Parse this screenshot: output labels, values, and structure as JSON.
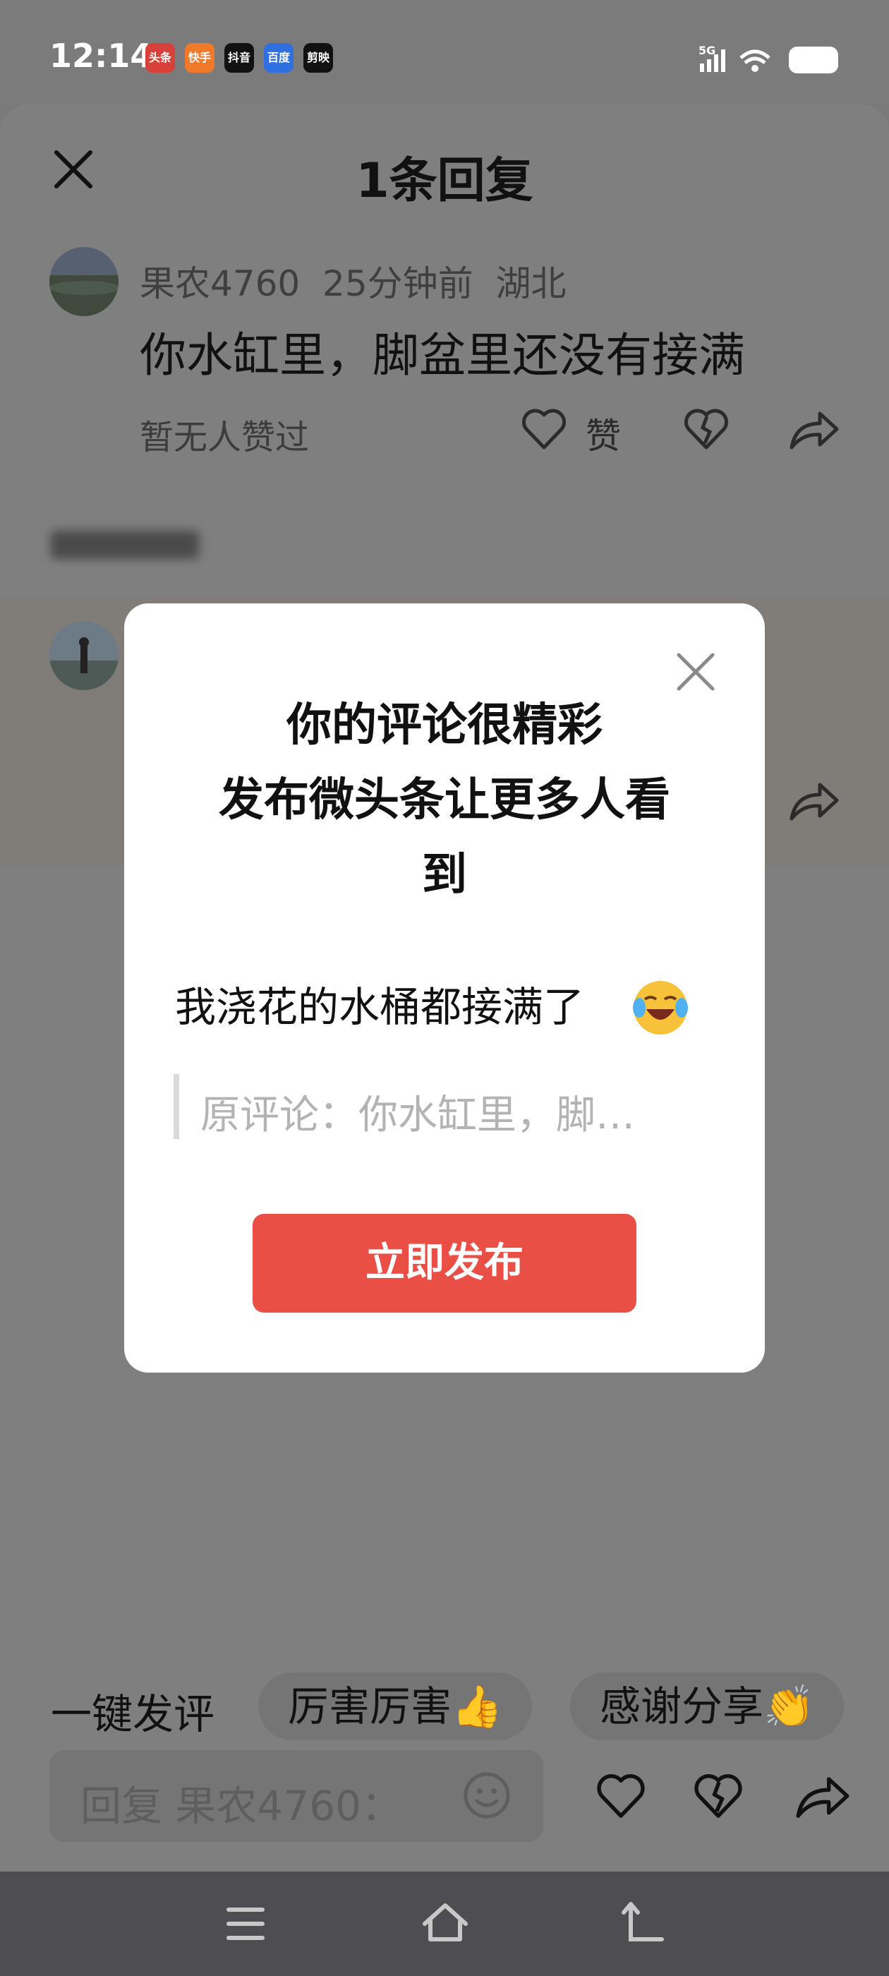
{
  "status_bar": {
    "time": "12:14",
    "apps": [
      "头条",
      "快手",
      "抖音",
      "百度",
      "剪映"
    ],
    "network": "5G"
  },
  "header": {
    "title": "1条回复",
    "close_icon": "close-icon"
  },
  "comment": {
    "meta": "果农4760  25分钟前  湖北",
    "text": "你水缸里，脚盆里还没有接满",
    "likes_text": "暂无人赞过",
    "like_label": "赞"
  },
  "modal": {
    "title_lines": [
      "你的评论很精彩",
      "发布微头条让更多人看",
      "到"
    ],
    "comment_text": "我浇花的水桶都接满了",
    "original_comment": "原评论：你水缸里，脚…",
    "publish_label": "立即发布"
  },
  "quick_comments": {
    "label": "一键发评",
    "chips": [
      "厉害厉害👍",
      "感谢分享👏"
    ]
  },
  "reply_bar": {
    "placeholder": "回复 果农4760："
  },
  "colors": {
    "accent": "#ea4f45",
    "overlay": "#7f7f7f"
  }
}
